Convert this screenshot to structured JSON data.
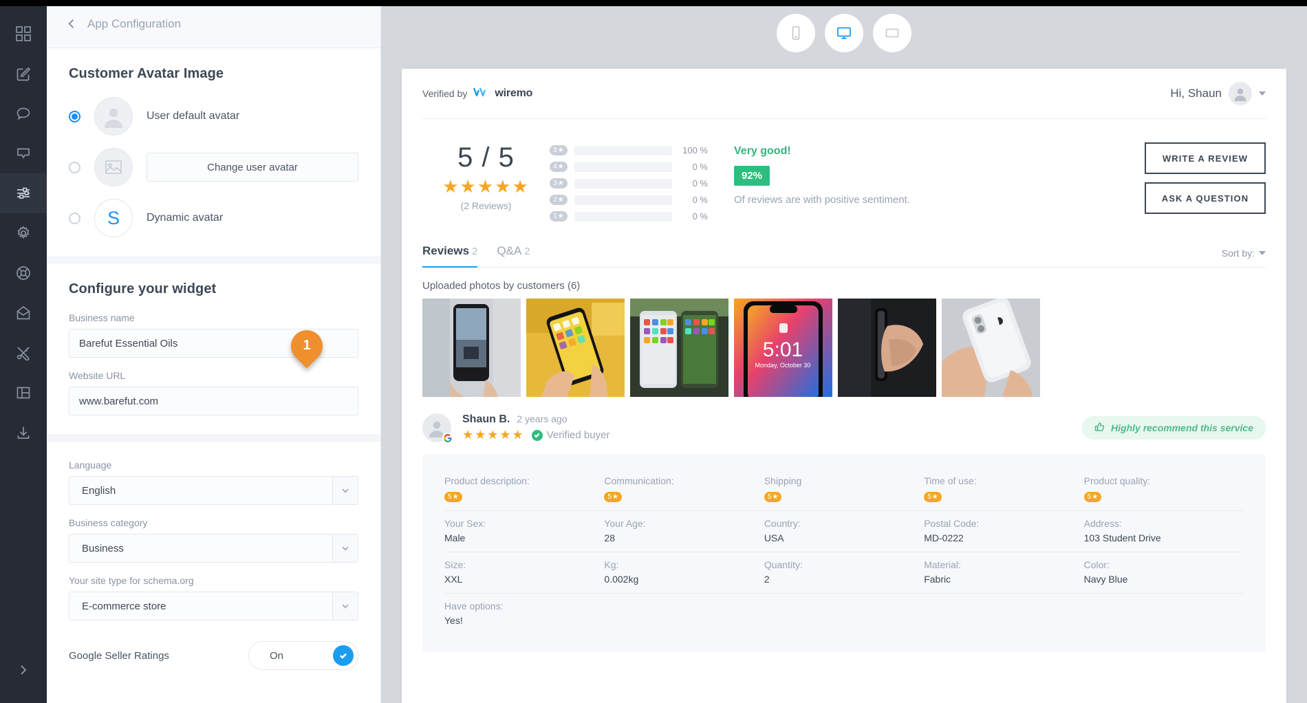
{
  "rail": {
    "items": [
      {
        "icon": "grid-icon",
        "name": "dashboard",
        "active": false
      },
      {
        "icon": "edit-icon",
        "name": "compose",
        "active": false
      },
      {
        "icon": "chat-bubble-icon",
        "name": "conversations",
        "active": false
      },
      {
        "icon": "message-box-icon",
        "name": "messages",
        "active": false
      },
      {
        "icon": "sliders-icon",
        "name": "settings-sliders",
        "active": true
      },
      {
        "icon": "gear-icon",
        "name": "settings",
        "active": false
      },
      {
        "icon": "lifebuoy-icon",
        "name": "support",
        "active": false
      },
      {
        "icon": "envelope-open-icon",
        "name": "inbox",
        "active": false
      },
      {
        "icon": "tools-icon",
        "name": "tools",
        "active": false
      },
      {
        "icon": "layout-icon",
        "name": "layout",
        "active": false
      },
      {
        "icon": "download-icon",
        "name": "download",
        "active": false
      }
    ],
    "expand_icon": "chevron-right-icon"
  },
  "config": {
    "header": {
      "back_icon": "chevron-left-icon",
      "title": "App Configuration"
    },
    "avatar_section": {
      "title": "Customer Avatar Image",
      "options": [
        {
          "label": "User default avatar",
          "selected": true,
          "avatar_kind": "person"
        },
        {
          "label": "Change user avatar",
          "selected": false,
          "avatar_kind": "image",
          "is_button": true
        },
        {
          "label": "Dynamic avatar",
          "selected": false,
          "avatar_kind": "letter",
          "letter": "S"
        }
      ]
    },
    "widget_section": {
      "title": "Configure your widget",
      "fields": [
        {
          "label": "Business name",
          "value": "Barefut Essential Oils"
        },
        {
          "label": "Website URL",
          "value": "www.barefut.com"
        }
      ]
    },
    "selects": [
      {
        "label": "Language",
        "value": "English"
      },
      {
        "label": "Business category",
        "value": "Business"
      },
      {
        "label": "Your site type for schema.org",
        "value": "E-commerce store"
      }
    ],
    "toggle": {
      "label": "Google Seller Ratings",
      "state": "On",
      "on": true
    },
    "marker": {
      "number": "1"
    }
  },
  "preview": {
    "devices": [
      {
        "name": "mobile",
        "icon": "phone-icon",
        "active": false
      },
      {
        "name": "desktop",
        "icon": "monitor-icon",
        "active": true
      },
      {
        "name": "tablet",
        "icon": "tablet-icon",
        "active": false
      }
    ],
    "widget": {
      "verified_by_label": "Verified by",
      "brand": "wiremo",
      "greeting": "Hi, Shaun",
      "summary": {
        "score": "5 / 5",
        "stars": "★★★★★",
        "reviews_count": "(2 Reviews)",
        "distribution": [
          {
            "stars": "5",
            "percent": "100 %",
            "fill": 100
          },
          {
            "stars": "4",
            "percent": "0 %",
            "fill": 0
          },
          {
            "stars": "3",
            "percent": "0 %",
            "fill": 0
          },
          {
            "stars": "2",
            "percent": "0 %",
            "fill": 0
          },
          {
            "stars": "1",
            "percent": "0 %",
            "fill": 0
          }
        ],
        "sentiment_title": "Very good!",
        "sentiment_percent": "92%",
        "sentiment_desc": "Of reviews are with positive sentiment."
      },
      "buttons": {
        "write_review": "WRITE A REVIEW",
        "ask_question": "ASK A QUESTION"
      },
      "tabs": [
        {
          "label": "Reviews",
          "count": "2",
          "active": true
        },
        {
          "label": "Q&A",
          "count": "2",
          "active": false
        }
      ],
      "sort_label": "Sort by:",
      "photos_title": "Uploaded photos by customers (6)",
      "photos": [
        {
          "alt": "phone-street-photo"
        },
        {
          "alt": "phone-taxi-photo"
        },
        {
          "alt": "two-phones-photo"
        },
        {
          "alt": "phone-lockscreen-photo"
        },
        {
          "alt": "phone-side-photo"
        },
        {
          "alt": "phone-back-photo"
        }
      ],
      "review": {
        "author": "Shaun B.",
        "date": "2 years ago",
        "stars": "★★★★★",
        "verified_label": "Verified buyer",
        "source_badge": "G",
        "recommend_label": "Highly recommend this service",
        "attributes": [
          [
            {
              "key": "Product description:",
              "value": "5",
              "type": "star"
            },
            {
              "key": "Communication:",
              "value": "5",
              "type": "star"
            },
            {
              "key": "Shipping",
              "value": "5",
              "type": "star"
            },
            {
              "key": "Time of use:",
              "value": "5",
              "type": "star"
            },
            {
              "key": "Product quality:",
              "value": "5",
              "type": "star"
            }
          ],
          [
            {
              "key": "Your Sex:",
              "value": "Male",
              "type": "text"
            },
            {
              "key": "Your Age:",
              "value": "28",
              "type": "text"
            },
            {
              "key": "Country:",
              "value": "USA",
              "type": "text"
            },
            {
              "key": "Postal Code:",
              "value": "MD-0222",
              "type": "text"
            },
            {
              "key": "Address:",
              "value": "103 Student Drive",
              "type": "text"
            }
          ],
          [
            {
              "key": "Size:",
              "value": "XXL",
              "type": "text"
            },
            {
              "key": "Kg:",
              "value": "0.002kg",
              "type": "text"
            },
            {
              "key": "Quantity:",
              "value": "2",
              "type": "text"
            },
            {
              "key": "Material:",
              "value": "Fabric",
              "type": "text"
            },
            {
              "key": "Color:",
              "value": "Navy Blue",
              "type": "text"
            }
          ],
          [
            {
              "key": "Have options:",
              "value": "Yes!",
              "type": "text"
            }
          ]
        ]
      }
    }
  },
  "colors": {
    "accent_blue": "#1a9cf0",
    "star_orange": "#f5a623",
    "sentiment_green": "#2fbd7f",
    "marker_orange": "#f08f2e",
    "rail_bg": "#262b35"
  }
}
